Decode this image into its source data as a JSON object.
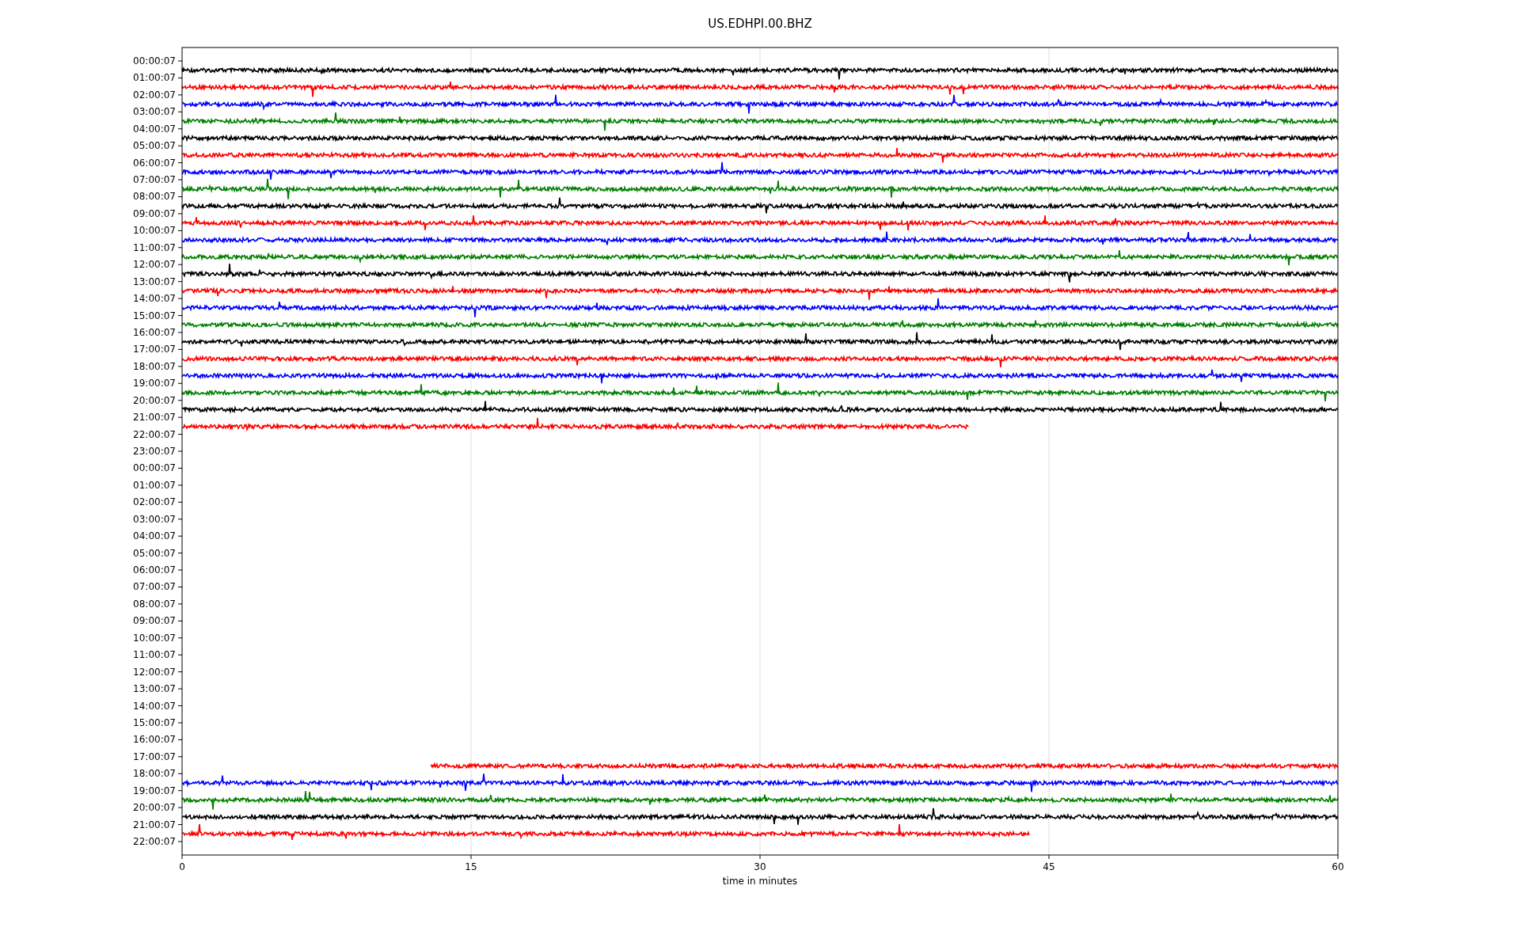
{
  "title": "US.EDHPI.00.BHZ",
  "y_labels": [
    "00:00:07",
    "01:00:07",
    "02:00:07",
    "03:00:07",
    "04:00:07",
    "05:00:07",
    "06:00:07",
    "07:00:07",
    "08:00:07",
    "09:00:07",
    "10:00:07",
    "11:00:07",
    "12:00:07",
    "13:00:07",
    "14:00:07",
    "15:00:07",
    "16:00:07",
    "17:00:07",
    "18:00:07",
    "19:00:07",
    "20:00:07",
    "21:00:07",
    "22:00:07",
    "23:00:07",
    "00:00:07",
    "01:00:07",
    "02:00:07",
    "03:00:07",
    "04:00:07",
    "05:00:07",
    "06:00:07",
    "07:00:07",
    "08:00:07",
    "09:00:07",
    "10:00:07",
    "11:00:07",
    "12:00:07",
    "13:00:07",
    "14:00:07",
    "15:00:07",
    "16:00:07",
    "17:00:07",
    "18:00:07",
    "19:00:07",
    "20:00:07",
    "21:00:07",
    "22:00:07"
  ],
  "x_ticks": [
    "0",
    "15",
    "30",
    "45",
    "60"
  ],
  "xlabel": "time in minutes",
  "traces": [
    {
      "kind": "full",
      "color": "#000000"
    },
    {
      "kind": "full",
      "color": "#ff0000"
    },
    {
      "kind": "full",
      "color": "#0000ff"
    },
    {
      "kind": "full",
      "color": "#008000"
    },
    {
      "kind": "full",
      "color": "#000000"
    },
    {
      "kind": "full",
      "color": "#ff0000"
    },
    {
      "kind": "full",
      "color": "#0000ff"
    },
    {
      "kind": "full",
      "color": "#008000"
    },
    {
      "kind": "full",
      "color": "#000000"
    },
    {
      "kind": "full",
      "color": "#ff0000"
    },
    {
      "kind": "full",
      "color": "#0000ff"
    },
    {
      "kind": "full",
      "color": "#008000"
    },
    {
      "kind": "full",
      "color": "#000000"
    },
    {
      "kind": "full",
      "color": "#ff0000"
    },
    {
      "kind": "full",
      "color": "#0000ff"
    },
    {
      "kind": "full",
      "color": "#008000"
    },
    {
      "kind": "full",
      "color": "#000000"
    },
    {
      "kind": "full",
      "color": "#ff0000"
    },
    {
      "kind": "full",
      "color": "#0000ff"
    },
    {
      "kind": "full",
      "color": "#008000"
    },
    {
      "kind": "full",
      "color": "#000000"
    },
    {
      "kind": "ends-early",
      "color": "#ff0000",
      "level": 0.68
    },
    {
      "kind": "empty"
    },
    {
      "kind": "empty"
    },
    {
      "kind": "empty"
    },
    {
      "kind": "empty"
    },
    {
      "kind": "empty"
    },
    {
      "kind": "empty"
    },
    {
      "kind": "empty"
    },
    {
      "kind": "empty"
    },
    {
      "kind": "empty"
    },
    {
      "kind": "empty"
    },
    {
      "kind": "empty"
    },
    {
      "kind": "empty"
    },
    {
      "kind": "empty"
    },
    {
      "kind": "empty"
    },
    {
      "kind": "empty"
    },
    {
      "kind": "empty"
    },
    {
      "kind": "empty"
    },
    {
      "kind": "empty"
    },
    {
      "kind": "empty"
    },
    {
      "kind": "starts-late",
      "color": "#ff0000",
      "level": 0.785
    },
    {
      "kind": "full",
      "color": "#0000ff"
    },
    {
      "kind": "full",
      "color": "#008000"
    },
    {
      "kind": "full",
      "color": "#000000"
    },
    {
      "kind": "ends-early",
      "color": "#ff0000",
      "level": 0.733
    }
  ]
}
